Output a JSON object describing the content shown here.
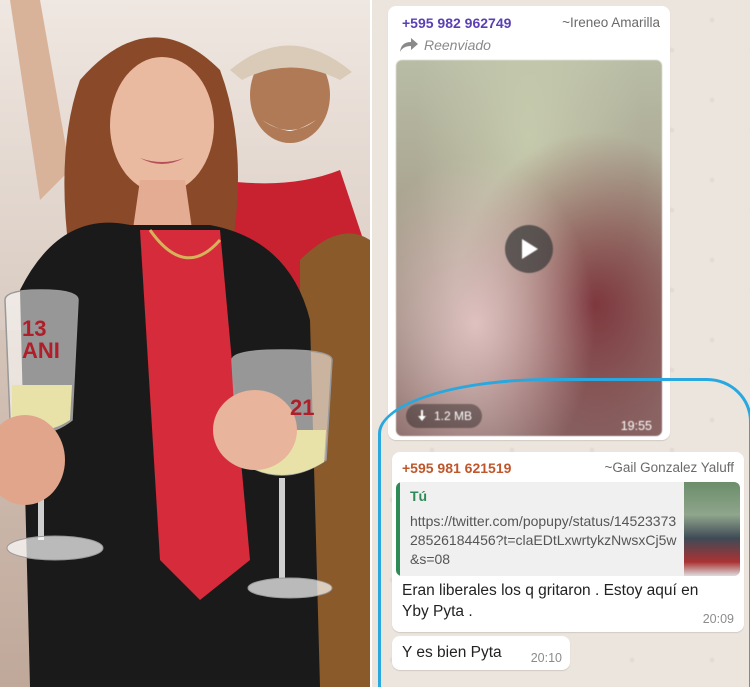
{
  "left_photo": {
    "glass_left_text": "13\nANI",
    "glass_right_text": "21"
  },
  "chat": {
    "message1": {
      "phone": "+595 982 962749",
      "name": "~Ireneo Amarilla",
      "forwarded_label": "Reenviado",
      "video_size": "1.2 MB",
      "time": "19:55",
      "phone_color": "#5b3fb5"
    },
    "message2": {
      "phone": "+595 981 621519",
      "name": "~Gail Gonzalez Yaluff",
      "quote_author": "Tú",
      "quote_url": "https://twitter.com/popupy/status/1452337328526184456?t=claEDtLxwrtykzNwsxCj5w&s=08",
      "text": "Eran liberales los q gritaron . Estoy aquí en Yby Pyta .",
      "time": "20:09",
      "phone_color": "#c0562b"
    },
    "message3": {
      "text": "Y es bien Pyta",
      "time": "20:10"
    }
  },
  "annotation": {
    "circle_color": "#29a8e0"
  },
  "icons": [
    "forward-icon",
    "play-icon",
    "download-icon"
  ]
}
